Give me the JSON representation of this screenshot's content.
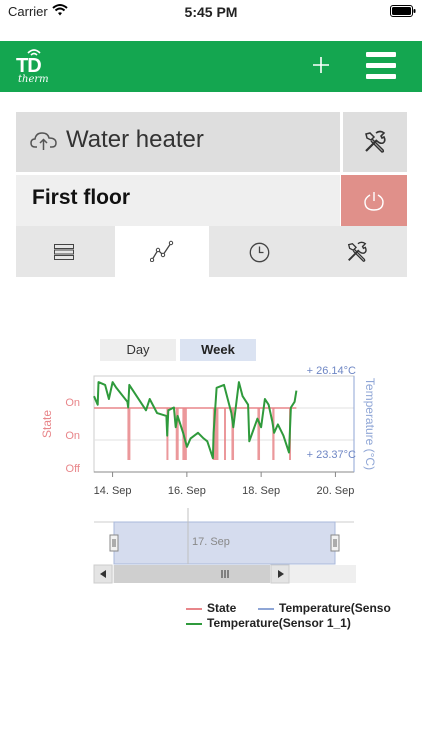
{
  "status_bar": {
    "carrier": "Carrier",
    "time": "5:45 PM"
  },
  "header": {
    "logo_primary": "TD",
    "logo_secondary": "therm",
    "add_icon": "plus-icon",
    "menu_icon": "hamburger-icon"
  },
  "device": {
    "name": "Water heater",
    "cloud_icon": "cloud-upload-icon",
    "settings_icon": "tools-icon"
  },
  "zone": {
    "name": "First floor",
    "power_icon": "power-icon",
    "power_color": "#e0908a"
  },
  "tabs": [
    {
      "icon": "list-icon",
      "active": false
    },
    {
      "icon": "chart-line-icon",
      "active": true
    },
    {
      "icon": "clock-icon",
      "active": false
    },
    {
      "icon": "tools-icon",
      "active": false
    }
  ],
  "period": {
    "day_label": "Day",
    "week_label": "Week",
    "selected": "Week"
  },
  "colors": {
    "brand": "#14a650",
    "state": "#e8868a",
    "temperature_sensor": "#8fa6d6",
    "temperature_sensor_1_1": "#2f9a3c"
  },
  "chart_data": {
    "type": "line",
    "x_ticks": [
      "14. Sep",
      "16. Sep",
      "18. Sep",
      "20. Sep"
    ],
    "left_axis": {
      "title": "State",
      "ticks": [
        "On",
        "On",
        "Off"
      ]
    },
    "right_axis": {
      "title": "Temperature (°C)",
      "max_label": "+ 26.14°C",
      "min_label": "+ 23.37°C",
      "range": [
        23.37,
        26.14
      ]
    },
    "x_range_days": [
      13.5,
      20.5
    ],
    "series": [
      {
        "name": "State",
        "type": "area",
        "color": "#e8868a",
        "on_intervals": [
          [
            14.4,
            14.48
          ],
          [
            15.45,
            15.5
          ],
          [
            15.7,
            15.78
          ],
          [
            15.88,
            16.0
          ],
          [
            16.7,
            16.85
          ],
          [
            17.0,
            17.04
          ],
          [
            17.2,
            17.27
          ],
          [
            17.9,
            17.97
          ],
          [
            18.3,
            18.36
          ],
          [
            18.75,
            18.8
          ]
        ]
      },
      {
        "name": "Temperature(Senso",
        "color": "#8fa6d6",
        "x": [],
        "y": []
      },
      {
        "name": "Temperature(Sensor 1_1)",
        "color": "#2f9a3c",
        "x": [
          13.5,
          13.6,
          13.62,
          13.8,
          13.9,
          14.0,
          14.1,
          14.4,
          14.42,
          14.45,
          14.55,
          14.65,
          14.9,
          15.0,
          15.2,
          15.45,
          15.47,
          15.5,
          15.65,
          15.7,
          15.75,
          15.9,
          16.0,
          16.1,
          16.3,
          16.45,
          16.55,
          16.7,
          16.72,
          16.8,
          17.0,
          17.2,
          17.25,
          17.4,
          17.5,
          17.65,
          17.68,
          17.9,
          18.0,
          18.1,
          18.2,
          18.3,
          18.35,
          18.45,
          18.6,
          18.75,
          18.8,
          18.9,
          18.95
        ],
        "y": [
          25.6,
          25.3,
          26.1,
          26.0,
          25.5,
          26.1,
          25.9,
          25.4,
          25.2,
          26.0,
          25.8,
          25.6,
          25.1,
          25.5,
          25.0,
          24.9,
          24.2,
          25.1,
          25.2,
          24.5,
          24.9,
          24.3,
          23.8,
          24.1,
          24.3,
          24.1,
          24.0,
          23.4,
          24.3,
          25.9,
          26.0,
          25.0,
          24.5,
          26.1,
          25.6,
          25.3,
          24.0,
          24.8,
          24.5,
          25.5,
          25.3,
          24.7,
          24.3,
          24.6,
          24.2,
          23.6,
          25.2,
          25.4,
          25.8
        ]
      }
    ],
    "navigator": {
      "label": "17. Sep"
    }
  },
  "legend": [
    {
      "label": "State",
      "color": "#e8868a"
    },
    {
      "label": "Temperature(Senso",
      "color": "#8fa6d6"
    },
    {
      "label": "Temperature(Sensor 1_1)",
      "color": "#2f9a3c"
    }
  ]
}
